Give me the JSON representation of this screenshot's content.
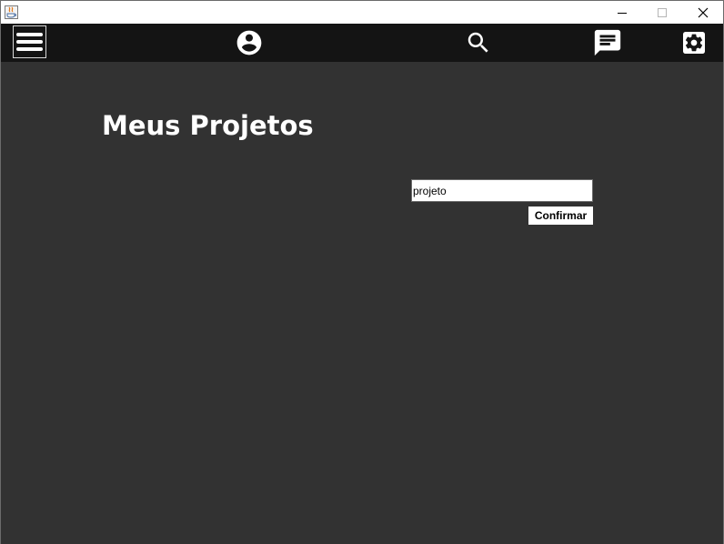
{
  "window": {
    "title": "",
    "controls": {
      "minimize_icon": "minimize-icon",
      "maximize_icon": "maximize-icon",
      "close_icon": "close-icon"
    }
  },
  "toolbar": {
    "background": "#141414",
    "items": [
      {
        "icon": "menu-icon"
      },
      {
        "icon": "account-circle-icon"
      },
      {
        "icon": "search-icon"
      },
      {
        "icon": "chat-icon"
      },
      {
        "icon": "settings-icon"
      }
    ]
  },
  "main": {
    "background": "#323232",
    "title": "Meus Projetos",
    "project_input": {
      "value": "projeto",
      "placeholder": ""
    },
    "confirm_label": "Confirmar"
  }
}
